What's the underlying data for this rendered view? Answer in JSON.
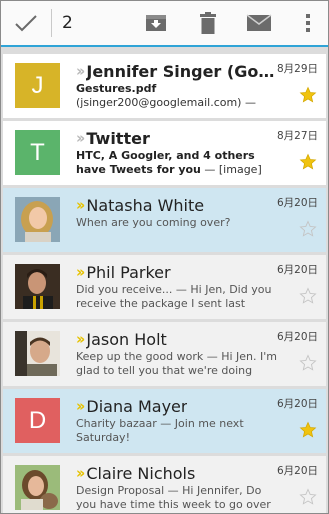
{
  "actionbar": {
    "selected_count": "2"
  },
  "colors": {
    "accent": "#2fa4d7",
    "star_on": "#f0c30f",
    "star_off": "#cfcfcf"
  },
  "messages": [
    {
      "sender": "Jennifer Singer (Googl…",
      "subject": "Gestures.pdf",
      "snippet": "(jsinger200@googlemail.com) — I've…",
      "date": "8月29日",
      "starred": true,
      "avatar_letter": "J",
      "avatar_color": "#d7b428"
    },
    {
      "sender": "Twitter",
      "subject": "HTC, A Googler, and 4 others have Tweets for you",
      "snippet": " — [image] Jennifer Sing…",
      "date": "8月27日",
      "starred": true,
      "avatar_letter": "T",
      "avatar_color": "#5bb46b"
    },
    {
      "sender": "Natasha White",
      "subject": "",
      "snippet": "When are you coming over?",
      "date": "6月20日",
      "starred": false,
      "avatar_letter": "",
      "avatar_color": ""
    },
    {
      "sender": "Phil Parker",
      "subject": "",
      "snippet": "Did you receive... — Hi Jen, Did you receive the package I sent last week?",
      "date": "6月20日",
      "starred": false,
      "avatar_letter": "",
      "avatar_color": ""
    },
    {
      "sender": "Jason Holt",
      "subject": "",
      "snippet": "Keep up the good work — Hi Jen. I'm glad to tell you that we're doing great progre…",
      "date": "6月20日",
      "starred": false,
      "avatar_letter": "",
      "avatar_color": ""
    },
    {
      "sender": "Diana Mayer",
      "subject": "",
      "snippet": "Charity bazaar — Join me next Saturday!",
      "date": "6月20日",
      "starred": true,
      "avatar_letter": "D",
      "avatar_color": "#e06060"
    },
    {
      "sender": "Claire Nichols",
      "subject": "",
      "snippet": "Design Proposal — Hi Jennifer, Do you have time this week to go over the…",
      "date": "6月20日",
      "starred": false,
      "avatar_letter": "",
      "avatar_color": ""
    }
  ]
}
